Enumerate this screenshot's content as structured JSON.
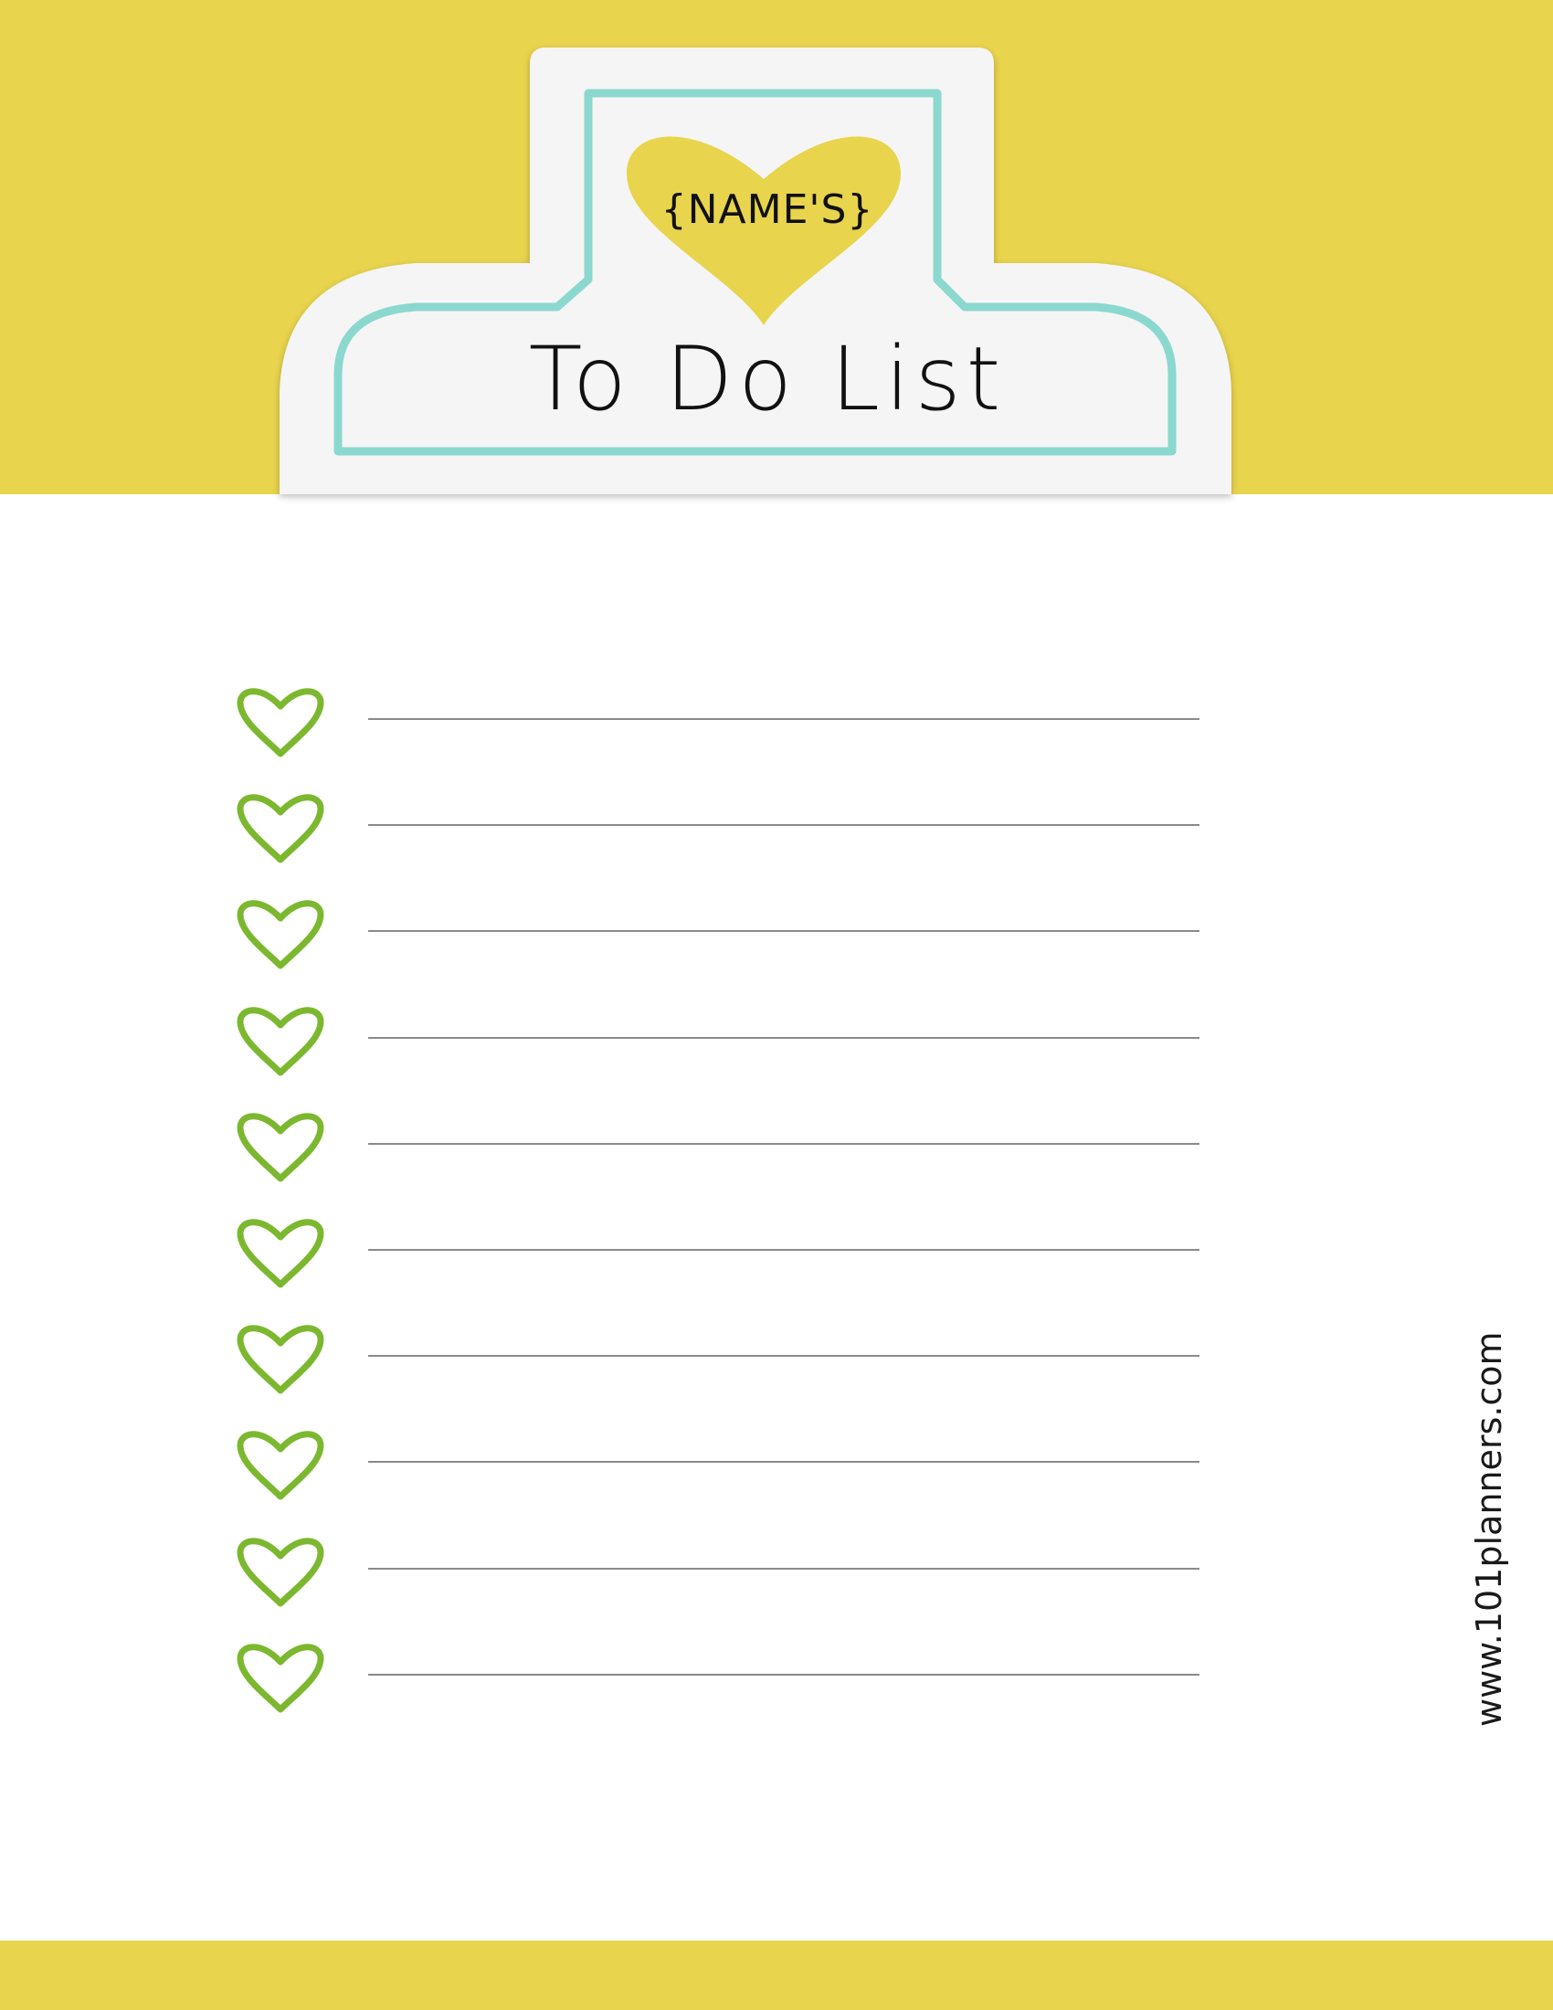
{
  "colors": {
    "band": "#e8d44d",
    "tab": "#f5f5f5",
    "tab_outline": "#8bd8cf",
    "title_heart": "#e8d44d",
    "checkbox_heart": "#7cb82f",
    "rule_line": "#8a8a8a"
  },
  "header": {
    "name_placeholder": "{NAME'S}",
    "title": "To Do List"
  },
  "list": {
    "checkbox_icon": "heart-outline-icon",
    "rows": [
      {
        "text": ""
      },
      {
        "text": ""
      },
      {
        "text": ""
      },
      {
        "text": ""
      },
      {
        "text": ""
      },
      {
        "text": ""
      },
      {
        "text": ""
      },
      {
        "text": ""
      },
      {
        "text": ""
      },
      {
        "text": ""
      }
    ]
  },
  "footer": {
    "website": "www.101planners.com"
  }
}
